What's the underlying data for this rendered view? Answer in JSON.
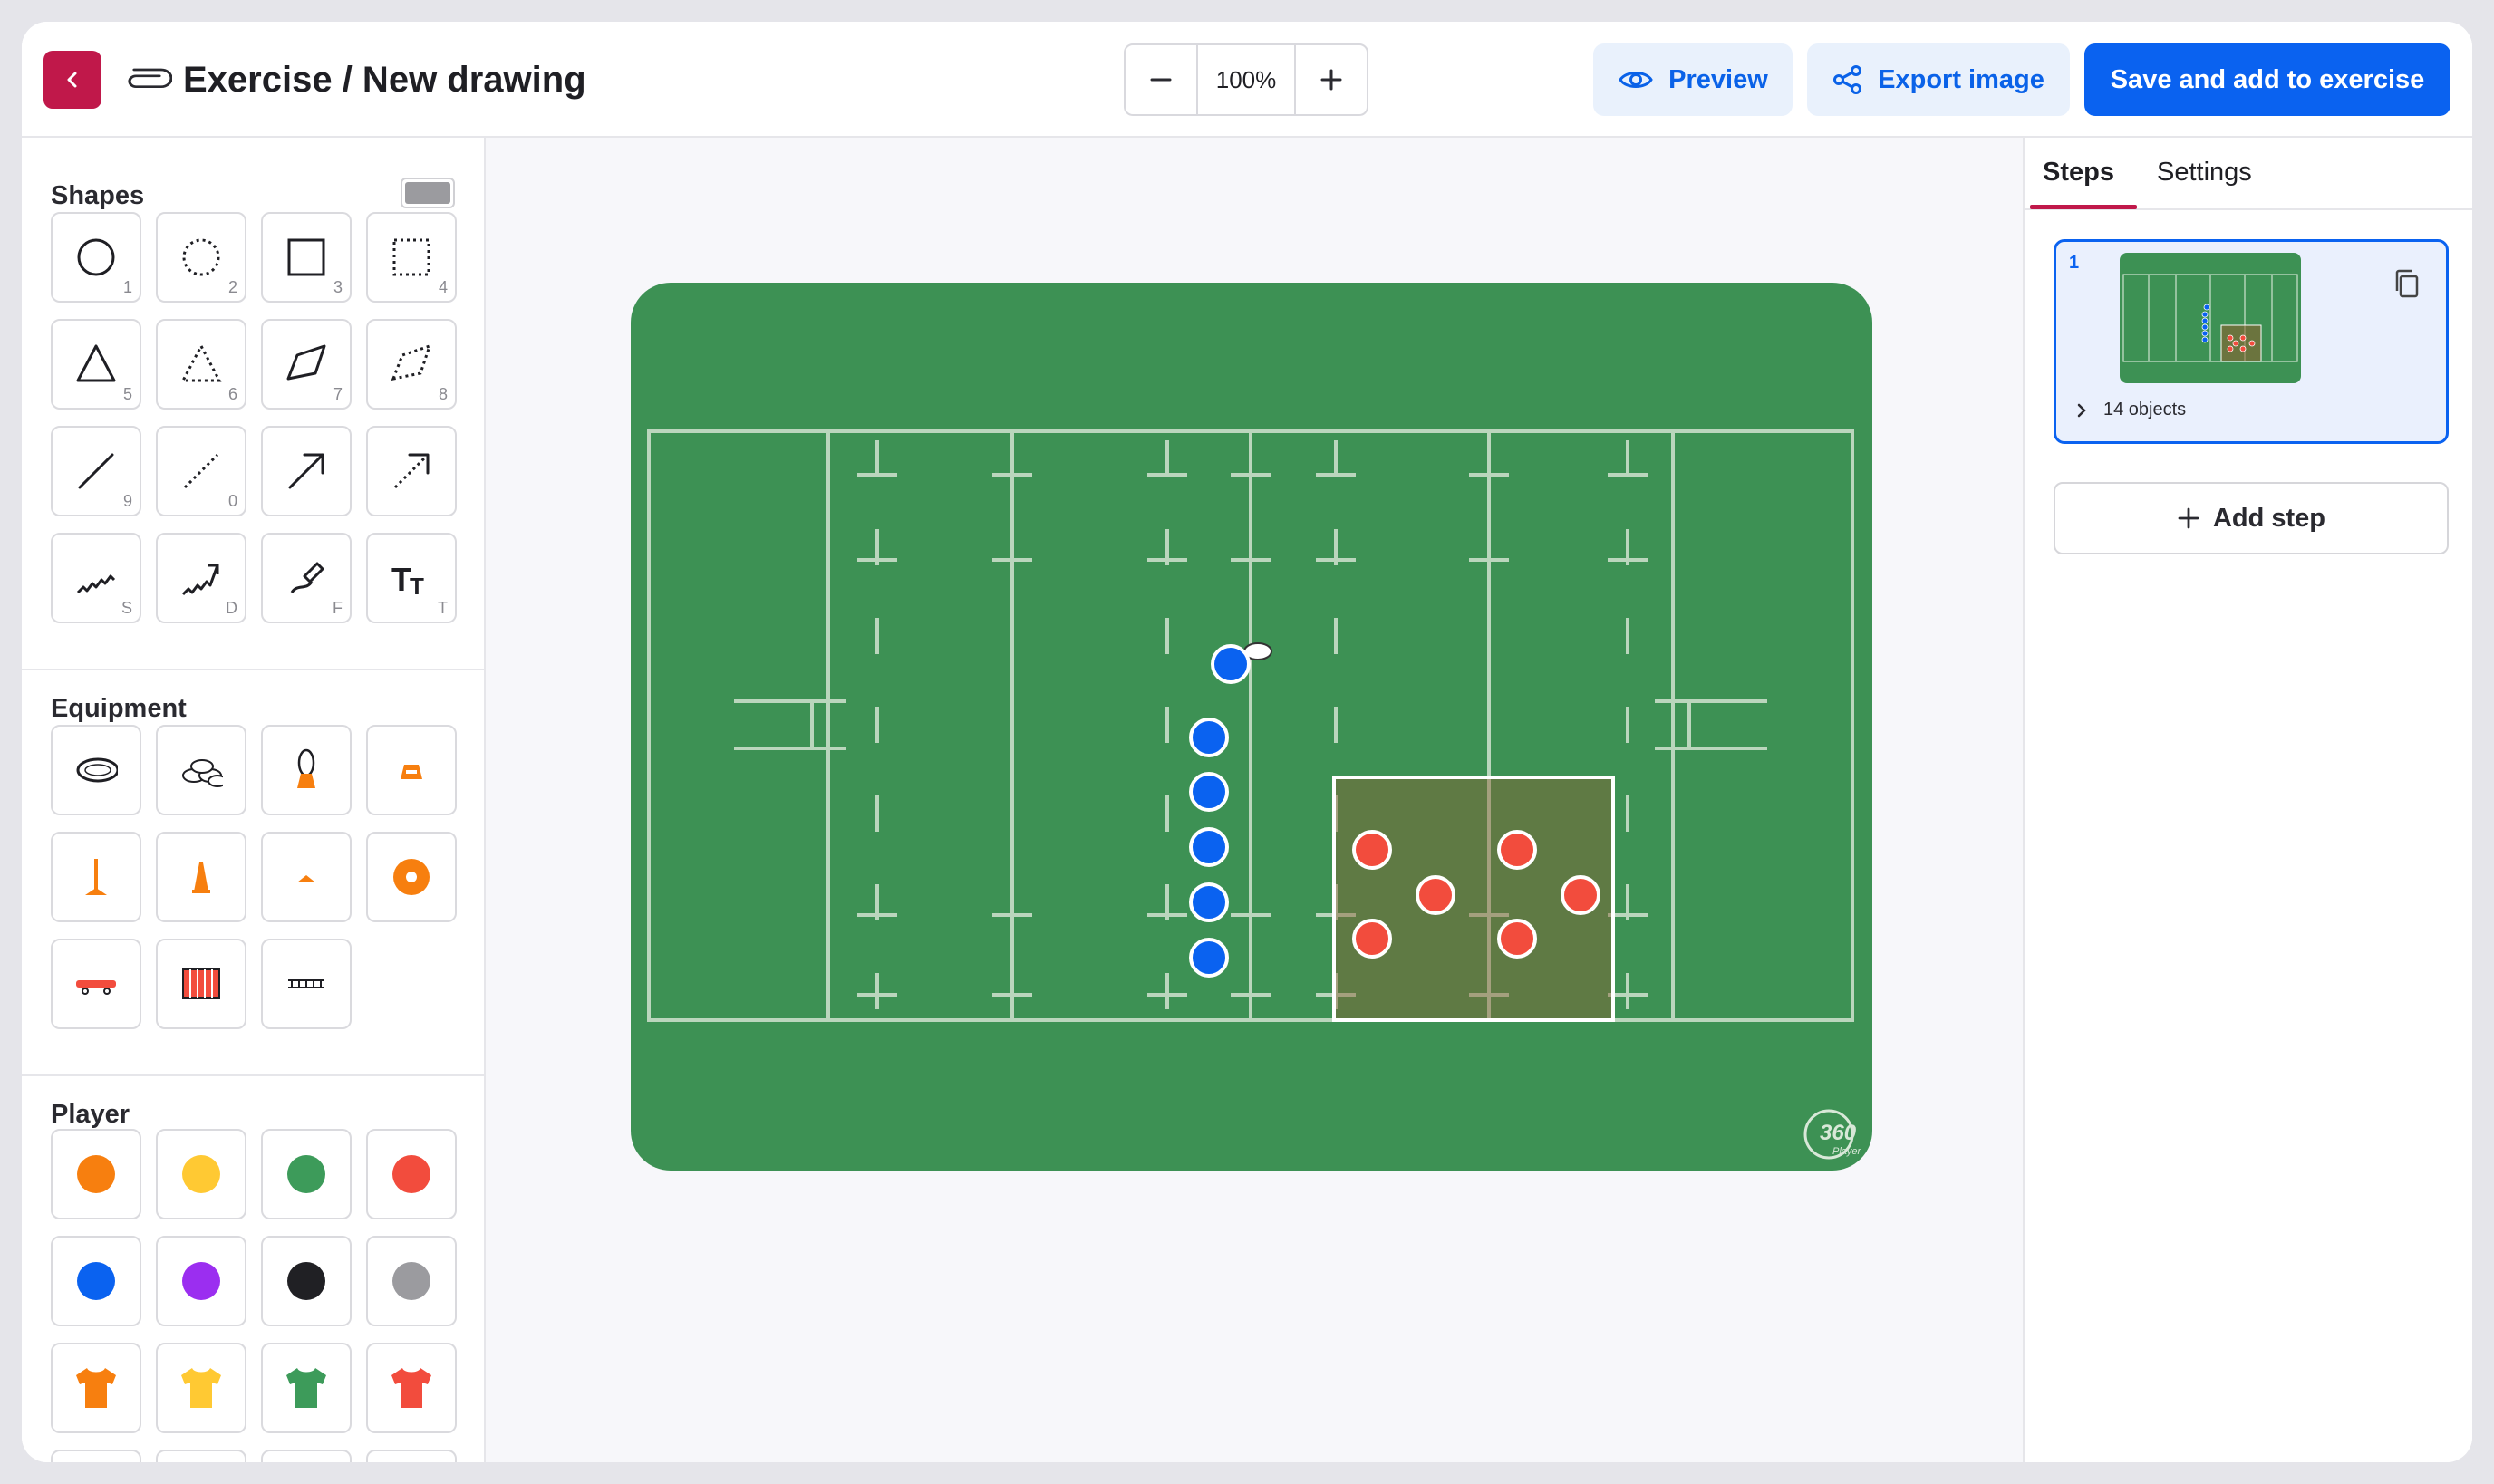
{
  "header": {
    "title": "Exercise / New drawing",
    "zoom_value": "100%",
    "preview_label": "Preview",
    "export_label": "Export image",
    "save_label": "Save and add to exercise"
  },
  "left_panel": {
    "shapes_title": "Shapes",
    "equipment_title": "Equipment",
    "player_title": "Player",
    "shape_keys": [
      "1",
      "2",
      "3",
      "4",
      "5",
      "6",
      "7",
      "8",
      "9",
      "0",
      "",
      "",
      "S",
      "D",
      "F",
      "T"
    ],
    "shape_icons": [
      "circle-icon",
      "dotted-circle-icon",
      "square-icon",
      "dotted-square-icon",
      "triangle-icon",
      "dotted-triangle-icon",
      "polygon-icon",
      "dotted-polygon-icon",
      "line-icon",
      "dotted-line-icon",
      "arrow-icon",
      "dotted-arrow-icon",
      "zigzag-line-icon",
      "zigzag-arrow-icon",
      "freehand-draw-icon",
      "text-tool-icon"
    ],
    "equipment_icons": [
      "ball-icon",
      "balls-bag-icon",
      "ball-on-tee-icon",
      "low-cone-icon",
      "pole-icon",
      "tall-cone-icon",
      "flat-marker-icon",
      "ring-marker-icon",
      "sled-icon",
      "goal-frame-icon",
      "agility-ladder-icon"
    ],
    "player_colors": [
      "#f77f0f",
      "#ffc933",
      "#3d9b5a",
      "#f24c3d",
      "#0a62f0",
      "#9b2ef0",
      "#202024",
      "#9b9b9f"
    ],
    "jersey_colors": [
      "#f77f0f",
      "#ffc933",
      "#3d9b5a",
      "#f24c3d"
    ],
    "swatch_color": "#9b9b9f"
  },
  "right_panel": {
    "tab_steps": "Steps",
    "tab_settings": "Settings",
    "step_number": "1",
    "step_objects": "14 objects",
    "add_step_label": "Add step"
  },
  "canvas": {
    "watermark": "360",
    "watermark_sub": "Player",
    "pitch_color": "#3d9154",
    "blue_team_color": "#0a62f0",
    "red_team_color": "#f24c3d"
  }
}
